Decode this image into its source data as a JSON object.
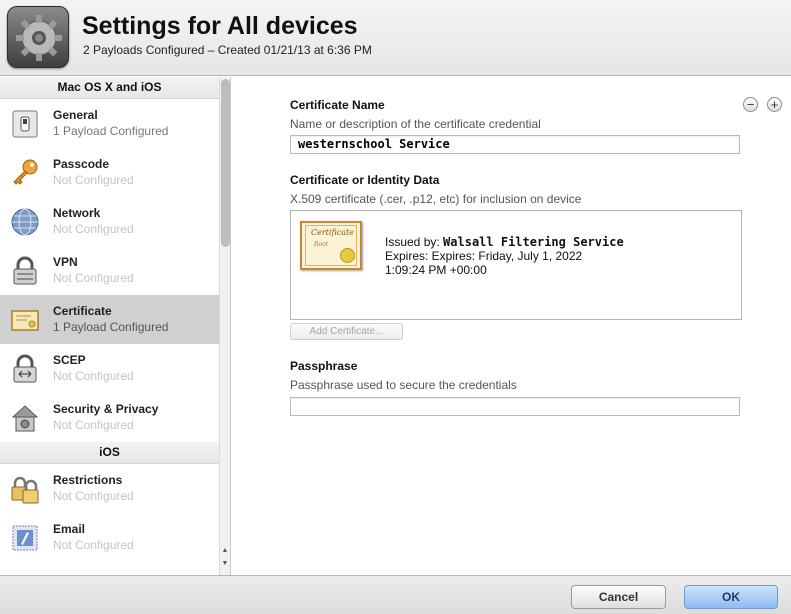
{
  "header": {
    "title": "Settings for All devices",
    "subtitle": "2 Payloads Configured – Created 01/21/13 at 6:36 PM",
    "icon": "settings-gear-icon"
  },
  "sidebar": {
    "sections": [
      {
        "title": "Mac OS X and iOS",
        "items": [
          {
            "name": "General",
            "status": "1 Payload Configured",
            "configured": true,
            "icon": "general-switch-icon"
          },
          {
            "name": "Passcode",
            "status": "Not Configured",
            "configured": false,
            "icon": "key-icon"
          },
          {
            "name": "Network",
            "status": "Not Configured",
            "configured": false,
            "icon": "globe-icon"
          },
          {
            "name": "VPN",
            "status": "Not Configured",
            "configured": false,
            "icon": "lock-icon"
          },
          {
            "name": "Certificate",
            "status": "1 Payload Configured",
            "configured": true,
            "selected": true,
            "icon": "certificate-icon"
          },
          {
            "name": "SCEP",
            "status": "Not Configured",
            "configured": false,
            "icon": "lock-exchange-icon"
          },
          {
            "name": "Security & Privacy",
            "status": "Not Configured",
            "configured": false,
            "icon": "house-security-icon"
          }
        ]
      },
      {
        "title": "iOS",
        "items": [
          {
            "name": "Restrictions",
            "status": "Not Configured",
            "configured": false,
            "icon": "padlocks-icon"
          },
          {
            "name": "Email",
            "status": "Not Configured",
            "configured": false,
            "icon": "stamp-icon"
          }
        ]
      }
    ]
  },
  "certificate_form": {
    "name_label": "Certificate Name",
    "name_desc": "Name or description of the certificate credential",
    "name_value": "westernschool Service",
    "data_label": "Certificate or Identity Data",
    "data_desc": "X.509 certificate (.cer, .p12, etc) for inclusion on device",
    "cert_image_title": "Certificate",
    "cert_image_sub": "Root",
    "issued_by_prefix": "Issued by:",
    "issued_by": "Walsall Filtering Service",
    "expires": "Expires: Expires: Friday, July 1, 2022",
    "expires_time": "1:09:24 PM +00:00",
    "add_button": "Add Certificate...",
    "passphrase_label": "Passphrase",
    "passphrase_desc": "Passphrase used to secure the credentials",
    "passphrase_value": ""
  },
  "controls": {
    "remove": "−",
    "add": "+"
  },
  "footer": {
    "cancel": "Cancel",
    "ok": "OK"
  },
  "colors": {
    "selected_row": "#d0d0d0",
    "ok_button": "#8fbcf1",
    "not_configured_text": "#c4c4c4"
  }
}
